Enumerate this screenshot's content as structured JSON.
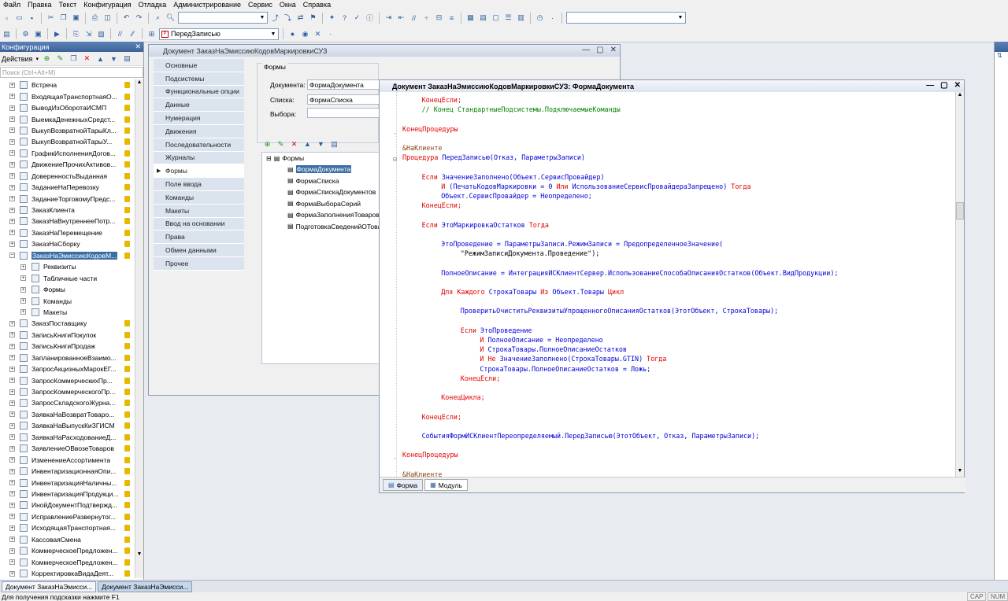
{
  "menu": [
    "Файл",
    "Правка",
    "Текст",
    "Конфигурация",
    "Отладка",
    "Администрирование",
    "Сервис",
    "Окна",
    "Справка"
  ],
  "toolbar2": {
    "proc_combo": "ПередЗаписью"
  },
  "config_panel": {
    "title": "Конфигурация",
    "actions_label": "Действия",
    "search_placeholder": "Поиск (Ctrl+Alt+M)",
    "items": [
      {
        "label": "Встреча",
        "locked": true
      },
      {
        "label": "ВходящаяТранспортнаяО...",
        "locked": true
      },
      {
        "label": "ВыводИзОборотаИСМП",
        "locked": true
      },
      {
        "label": "ВыемкаДенежныхСредст...",
        "locked": true
      },
      {
        "label": "ВыкупВозвратнойТарыКл...",
        "locked": true
      },
      {
        "label": "ВыкупВозвратнойТарыУ...",
        "locked": true
      },
      {
        "label": "ГрафикИсполненияДогов...",
        "locked": true
      },
      {
        "label": "ДвижениеПрочихАктивов...",
        "locked": true
      },
      {
        "label": "ДоверенностьВыданная",
        "locked": true
      },
      {
        "label": "ЗаданиеНаПеревозку",
        "locked": true
      },
      {
        "label": "ЗаданиеТорговомуПредс...",
        "locked": true
      },
      {
        "label": "ЗаказКлиента",
        "locked": true
      },
      {
        "label": "ЗаказНаВнутреннееПотр...",
        "locked": true
      },
      {
        "label": "ЗаказНаПеремещение",
        "locked": true
      },
      {
        "label": "ЗаказНаСборку",
        "locked": true
      },
      {
        "label": "ЗаказНаЭмиссиюКодовМ...",
        "locked": true,
        "selected": true,
        "expanded": true
      }
    ],
    "children": [
      "Реквизиты",
      "Табличные части",
      "Формы",
      "Команды",
      "Макеты"
    ],
    "items2": [
      {
        "label": "ЗаказПоставщику",
        "locked": true
      },
      {
        "label": "ЗаписьКнигиПокупок",
        "locked": true
      },
      {
        "label": "ЗаписьКнигиПродаж",
        "locked": true
      },
      {
        "label": "ЗапланированноеВзаимо...",
        "locked": true
      },
      {
        "label": "ЗапросАкцизныхМарокЕГ...",
        "locked": true
      },
      {
        "label": "ЗапросКоммерческихПр...",
        "locked": true
      },
      {
        "label": "ЗапросКоммерческогоПр...",
        "locked": true
      },
      {
        "label": "ЗапросСкладскогоЖурна...",
        "locked": true
      },
      {
        "label": "ЗаявкаНаВозвратТоваро...",
        "locked": true
      },
      {
        "label": "ЗаявкаНаВыпускКиЗГИСМ",
        "locked": true
      },
      {
        "label": "ЗаявкаНаРасходованиеД...",
        "locked": true
      },
      {
        "label": "ЗаявлениеОВвозеТоваров",
        "locked": true
      },
      {
        "label": "ИзменениеАссортимента",
        "locked": true
      },
      {
        "label": "ИнвентаризационнаяОпи...",
        "locked": true
      },
      {
        "label": "ИнвентаризацияНаличны...",
        "locked": true
      },
      {
        "label": "ИнвентаризацияПродукци...",
        "locked": true
      },
      {
        "label": "ИнойДокументПодтвержд...",
        "locked": true
      },
      {
        "label": "ИсправлениеРазвернутог...",
        "locked": true
      },
      {
        "label": "ИсходящаяТранспортная...",
        "locked": true
      },
      {
        "label": "КассоваяСмена",
        "locked": true
      },
      {
        "label": "КоммерческоеПредложен...",
        "locked": true
      },
      {
        "label": "КоммерческоеПредложен...",
        "locked": true
      },
      {
        "label": "КорректировкаВидаДеят...",
        "locked": true
      }
    ]
  },
  "doc_window": {
    "title": "Документ ЗаказНаЭмиссиюКодовМаркировкиСУЗ",
    "nav": [
      "Основные",
      "Подсистемы",
      "Функциональные опции",
      "Данные",
      "Нумерация",
      "Движения",
      "Последовательности",
      "Журналы",
      "Формы",
      "Поле ввода",
      "Команды",
      "Макеты",
      "Ввод на основании",
      "Права",
      "Обмен данными",
      "Прочее"
    ],
    "nav_selected": "Формы",
    "group_title": "Формы",
    "doc_label": "Документа:",
    "doc_value": "ФормаДокумента",
    "list_label": "Списка:",
    "list_value": "ФормаСписка",
    "select_label": "Выбора:",
    "select_value": "",
    "forms_root": "Формы",
    "forms": [
      "ФормаДокумента",
      "ФормаСписка",
      "ФормаСпискаДокументов",
      "ФормаВыбораСерий",
      "ФормаЗаполненияТоваров",
      "ПодготовкаСведенийОТоварах"
    ]
  },
  "code_window": {
    "title": "Документ ЗаказНаЭмиссиюКодовМаркировкиСУЗ: ФормаДокумента",
    "tabs": [
      "Форма",
      "Модуль"
    ],
    "lines": [
      {
        "t": "kw",
        "x": 2,
        "s": "КонецЕсли;"
      },
      {
        "t": "cm",
        "x": 2,
        "s": "// Конец СтандартныеПодсистемы.ПодключаемыеКоманды"
      },
      {
        "t": "blank"
      },
      {
        "t": "kw",
        "x": 0,
        "s": "КонецПроцедуры"
      },
      {
        "t": "blank"
      },
      {
        "t": "pp",
        "x": 0,
        "s": "&НаКлиенте"
      },
      {
        "t": "mix",
        "x": 0,
        "parts": [
          [
            "kw",
            "Процедура "
          ],
          [
            "id",
            "ПередЗаписью(Отказ, ПараметрыЗаписи)"
          ]
        ]
      },
      {
        "t": "blank"
      },
      {
        "t": "mix",
        "x": 2,
        "parts": [
          [
            "kw",
            "Если "
          ],
          [
            "id",
            "ЗначениеЗаполнено(Объект.СервисПровайдер)"
          ]
        ]
      },
      {
        "t": "mix",
        "x": 4,
        "parts": [
          [
            "kw",
            "И "
          ],
          [
            "id",
            "(ПечатьКодовМаркировки = 0 "
          ],
          [
            "kw",
            "Или "
          ],
          [
            "id",
            "ИспользованиеСервисПровайдераЗапрещено) "
          ],
          [
            "kw",
            "Тогда"
          ]
        ]
      },
      {
        "t": "id",
        "x": 4,
        "s": "Объект.СервисПровайдер = Неопределено;"
      },
      {
        "t": "kw",
        "x": 2,
        "s": "КонецЕсли;"
      },
      {
        "t": "blank"
      },
      {
        "t": "mix",
        "x": 2,
        "parts": [
          [
            "kw",
            "Если "
          ],
          [
            "id",
            "ЭтоМаркировкаОстатков "
          ],
          [
            "kw",
            "Тогда"
          ]
        ]
      },
      {
        "t": "blank"
      },
      {
        "t": "id",
        "x": 4,
        "s": "ЭтоПроведение = ПараметрыЗаписи.РежимЗаписи = ПредопределенноеЗначение("
      },
      {
        "t": "st",
        "x": 6,
        "s": "\"РежимЗаписиДокумента.Проведение\");"
      },
      {
        "t": "blank"
      },
      {
        "t": "id",
        "x": 4,
        "s": "ПолноеОписание = ИнтеграцияИСКлиентСервер.ИспользованиеСпособаОписанияОстатков(Объект.ВидПродукции);"
      },
      {
        "t": "blank"
      },
      {
        "t": "mix",
        "x": 4,
        "parts": [
          [
            "kw",
            "Для Каждого "
          ],
          [
            "id",
            "СтрокаТовары "
          ],
          [
            "kw",
            "Из "
          ],
          [
            "id",
            "Объект.Товары "
          ],
          [
            "kw",
            "Цикл"
          ]
        ]
      },
      {
        "t": "blank"
      },
      {
        "t": "id",
        "x": 6,
        "s": "ПроверитьОчиститьРеквизитыУпрощенногоОписанияОстатков(ЭтотОбъект, СтрокаТовары);"
      },
      {
        "t": "blank"
      },
      {
        "t": "mix",
        "x": 6,
        "parts": [
          [
            "kw",
            "Если "
          ],
          [
            "id",
            "ЭтоПроведение"
          ]
        ]
      },
      {
        "t": "mix",
        "x": 8,
        "parts": [
          [
            "kw",
            "И "
          ],
          [
            "id",
            "ПолноеОписание = Неопределено"
          ]
        ]
      },
      {
        "t": "mix",
        "x": 8,
        "parts": [
          [
            "kw",
            "И "
          ],
          [
            "id",
            "СтрокаТовары.ПолноеОписаниеОстатков"
          ]
        ]
      },
      {
        "t": "mix",
        "x": 8,
        "parts": [
          [
            "kw",
            "И Не "
          ],
          [
            "id",
            "ЗначениеЗаполнено(СтрокаТовары.GTIN) "
          ],
          [
            "kw",
            "Тогда"
          ]
        ]
      },
      {
        "t": "id",
        "x": 8,
        "s": "СтрокаТовары.ПолноеОписаниеОстатков = Ложь;"
      },
      {
        "t": "kw",
        "x": 6,
        "s": "КонецЕсли;"
      },
      {
        "t": "blank"
      },
      {
        "t": "kw",
        "x": 4,
        "s": "КонецЦикла;"
      },
      {
        "t": "blank"
      },
      {
        "t": "kw",
        "x": 2,
        "s": "КонецЕсли;"
      },
      {
        "t": "blank"
      },
      {
        "t": "id",
        "x": 2,
        "s": "СобытияФормИСКлиентПереопределяемый.ПередЗаписью(ЭтотОбъект, Отказ, ПараметрыЗаписи);"
      },
      {
        "t": "blank"
      },
      {
        "t": "kw",
        "x": 0,
        "s": "КонецПроцедуры"
      },
      {
        "t": "blank"
      },
      {
        "t": "pp",
        "x": 0,
        "s": "&НаКлиенте"
      }
    ]
  },
  "taskbar": [
    "Документ ЗаказНаЭмисси...",
    "Документ ЗаказНаЭмисси..."
  ],
  "status_text": "Для получения подсказки нажмите F1",
  "status_ind": [
    "CAP",
    "NUM"
  ],
  "colors": {
    "keyword": "#e00000",
    "identifier": "#0000d8",
    "comment": "#008000",
    "selection": "#3b6ea5"
  }
}
